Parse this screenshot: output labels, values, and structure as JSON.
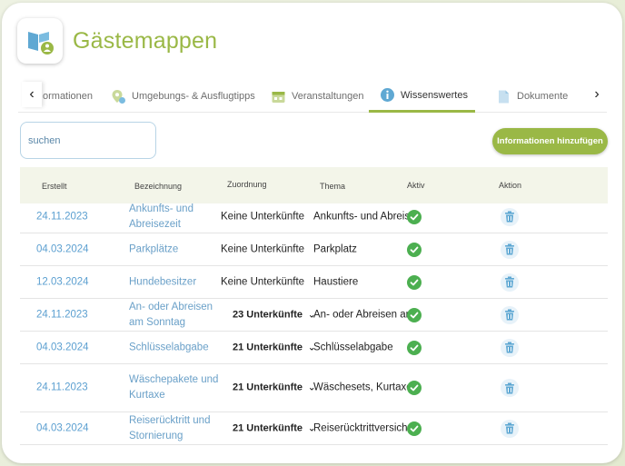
{
  "app": {
    "title": "Gästemappen"
  },
  "tabs": [
    {
      "label": "ormationen",
      "icon": "info-icon"
    },
    {
      "label": "Umgebungs- & Ausflugtipps",
      "icon": "map-pin-icon"
    },
    {
      "label": "Veranstaltungen",
      "icon": "calendar-icon"
    },
    {
      "label": "Wissenswertes",
      "icon": "info-icon",
      "active": true
    },
    {
      "label": "Dokumente",
      "icon": "document-icon"
    }
  ],
  "search": {
    "placeholder": "suchen",
    "value": ""
  },
  "toolbar": {
    "add_label": "Informationen hinzufügen"
  },
  "table": {
    "headers": {
      "created": "Erstellt",
      "name": "Bezeichnung",
      "assignment": "Zuordnung",
      "theme": "Thema",
      "active": "Aktiv",
      "action": "Aktion"
    },
    "rows": [
      {
        "created": "24.11.2023",
        "name": "Ankunfts- und Abreisezeit",
        "assignment": "Keine Unterkünfte",
        "dropdown": false,
        "theme": "Ankunfts- und Abreisezeit",
        "active": true
      },
      {
        "created": "04.03.2024",
        "name": "Parkplätze",
        "assignment": "Keine Unterkünfte",
        "dropdown": false,
        "theme": "Parkplatz",
        "active": true
      },
      {
        "created": "12.03.2024",
        "name": "Hundebesitzer",
        "assignment": "Keine Unterkünfte",
        "dropdown": false,
        "theme": "Haustiere",
        "active": true
      },
      {
        "created": "24.11.2023",
        "name": "An- oder Abreisen am Sonntag",
        "assignment": "23 Unterkünfte",
        "dropdown": true,
        "theme": "An- oder Abreisen am Sonntag",
        "active": true
      },
      {
        "created": "04.03.2024",
        "name": "Schlüsselabgabe",
        "assignment": "21 Unterkünfte",
        "dropdown": true,
        "theme": "Schlüsselabgabe",
        "active": true
      },
      {
        "created": "24.11.2023",
        "name": "Wäschepakete und Kurtaxe",
        "assignment": "21 Unterkünfte",
        "dropdown": true,
        "theme": "Wäschesets, Kurtaxen und Endreinigung",
        "active": true
      },
      {
        "created": "04.03.2024",
        "name": "Reiserücktritt und Stornierung",
        "assignment": "21 Unterkünfte",
        "dropdown": true,
        "theme": "Reiserücktrittversiche",
        "active": true
      }
    ]
  },
  "colors": {
    "brand": "#9ab846",
    "link": "#5b9fd0",
    "check": "#4caf50",
    "icon": "#5fa8d3"
  }
}
